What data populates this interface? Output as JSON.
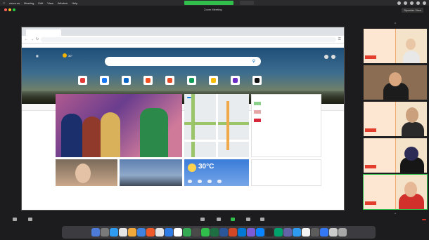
{
  "menubar": {
    "items": [
      "zoom.us",
      "Meeting",
      "Edit",
      "View",
      "Window",
      "Help"
    ],
    "share_status": "",
    "right_time": ""
  },
  "zoom": {
    "window_title": "Zoom Meeting",
    "speaker_view_label": "Speaker View",
    "top_left_badge": ""
  },
  "chrome": {
    "tab_title": "",
    "url": "",
    "bookmarks_text": ""
  },
  "msn": {
    "brand": "",
    "weather_temp": "30°",
    "search_placeholder": "",
    "quicklinks": [
      {
        "label": "",
        "color": "#e53935"
      },
      {
        "label": "",
        "color": "#1877f2"
      },
      {
        "label": "",
        "color": "#0a66c2"
      },
      {
        "label": "",
        "color": "#f25022"
      },
      {
        "label": "",
        "color": "#e44d26"
      },
      {
        "label": "",
        "color": "#0f9d58"
      },
      {
        "label": "",
        "color": "#fbbc04"
      },
      {
        "label": "",
        "color": "#6c2dc7"
      },
      {
        "label": "",
        "color": "#111111"
      }
    ],
    "hero_caption": ""
  },
  "feed_nav": {
    "items": [],
    "personalize": ""
  },
  "feed": {
    "hero_headline": "",
    "hero_source": "",
    "map_badge": "",
    "side_title": "",
    "side_rows": [],
    "side_see_all": "",
    "weather_temp": "30°C",
    "news_title": "",
    "news_line": ""
  },
  "participants": [
    {
      "name": "",
      "highlight": false
    },
    {
      "name": "",
      "highlight": false
    },
    {
      "name": "",
      "highlight": false
    },
    {
      "name": "",
      "highlight": false
    },
    {
      "name": "",
      "highlight": true
    }
  ],
  "controls": {
    "mute": "",
    "stop_video": "",
    "participants_count": "",
    "chat": "",
    "share": "",
    "record": "",
    "reactions": "",
    "end": ""
  },
  "dock_apps": [
    "#4e7bd9",
    "#7a7a7a",
    "#2f9bf0",
    "#e6e6e6",
    "#f2a93b",
    "#3e83e0",
    "#f05a28",
    "#e5e5e5",
    "#2f7be5",
    "#ffffff",
    "#34a853",
    "#4a4a4a",
    "#2fbf4a",
    "#1d6f42",
    "#2b579a",
    "#d24726",
    "#0078d4",
    "#7b5cd6",
    "#0a84ff",
    "#2a2a2a",
    "#00a36c",
    "#6264a7",
    "#2f9bf0",
    "#f4f4f4",
    "#5c5c5c",
    "#3478f6",
    "#cccccc",
    "#a8a8a8"
  ]
}
